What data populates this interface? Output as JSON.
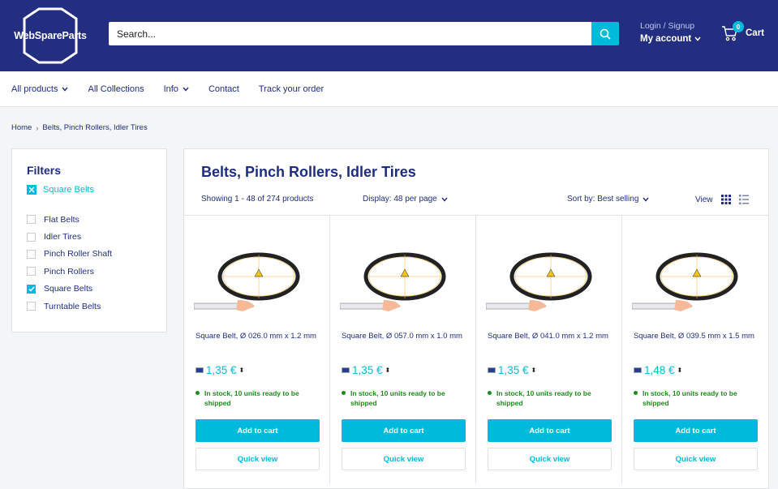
{
  "header": {
    "logo_text": "WebSpareParts",
    "search_placeholder": "Search...",
    "account_login": "Login / Signup",
    "account_label": "My account",
    "cart_count": "0",
    "cart_label": "Cart"
  },
  "nav": {
    "items": [
      {
        "label": "All products"
      },
      {
        "label": "All Collections"
      },
      {
        "label": "Info"
      },
      {
        "label": "Contact"
      },
      {
        "label": "Track your order"
      }
    ]
  },
  "breadcrumb": {
    "home": "Home",
    "current": "Belts, Pinch Rollers, Idler Tires"
  },
  "filters": {
    "title": "Filters",
    "active": "Square Belts",
    "items": [
      {
        "label": "Flat Belts",
        "checked": false
      },
      {
        "label": "Idler Tires",
        "checked": false
      },
      {
        "label": "Pinch Roller Shaft",
        "checked": false
      },
      {
        "label": "Pinch Rollers",
        "checked": false
      },
      {
        "label": "Square Belts",
        "checked": true
      },
      {
        "label": "Turntable Belts",
        "checked": false
      }
    ]
  },
  "main": {
    "title": "Belts, Pinch Rollers, Idler Tires",
    "showing": "Showing 1 - 48 of 274 products",
    "display": "Display: 48 per page",
    "sort": "Sort by: Best selling",
    "view": "View"
  },
  "products": [
    {
      "title": "Square Belt, Ø 026.0 mm x 1.2 mm",
      "price": "1,35 €",
      "stock": "In stock, 10 units ready to be shipped",
      "add": "Add to cart",
      "quick": "Quick view"
    },
    {
      "title": "Square Belt, Ø 057.0 mm x 1.0 mm",
      "price": "1,35 €",
      "stock": "In stock, 10 units ready to be shipped",
      "add": "Add to cart",
      "quick": "Quick view"
    },
    {
      "title": "Square Belt, Ø 041.0 mm x 1.2 mm",
      "price": "1,35 €",
      "stock": "In stock, 10 units ready to be shipped",
      "add": "Add to cart",
      "quick": "Quick view"
    },
    {
      "title": "Square Belt, Ø 039.5 mm x 1.5 mm",
      "price": "1,48 €",
      "stock": "In stock, 10 units ready to be shipped",
      "add": "Add to cart",
      "quick": "Quick view"
    }
  ],
  "colors": {
    "header_bg": "#232e80",
    "accent": "#00badb",
    "text": "#1e2d7d",
    "stock": "#1c8a1c"
  }
}
